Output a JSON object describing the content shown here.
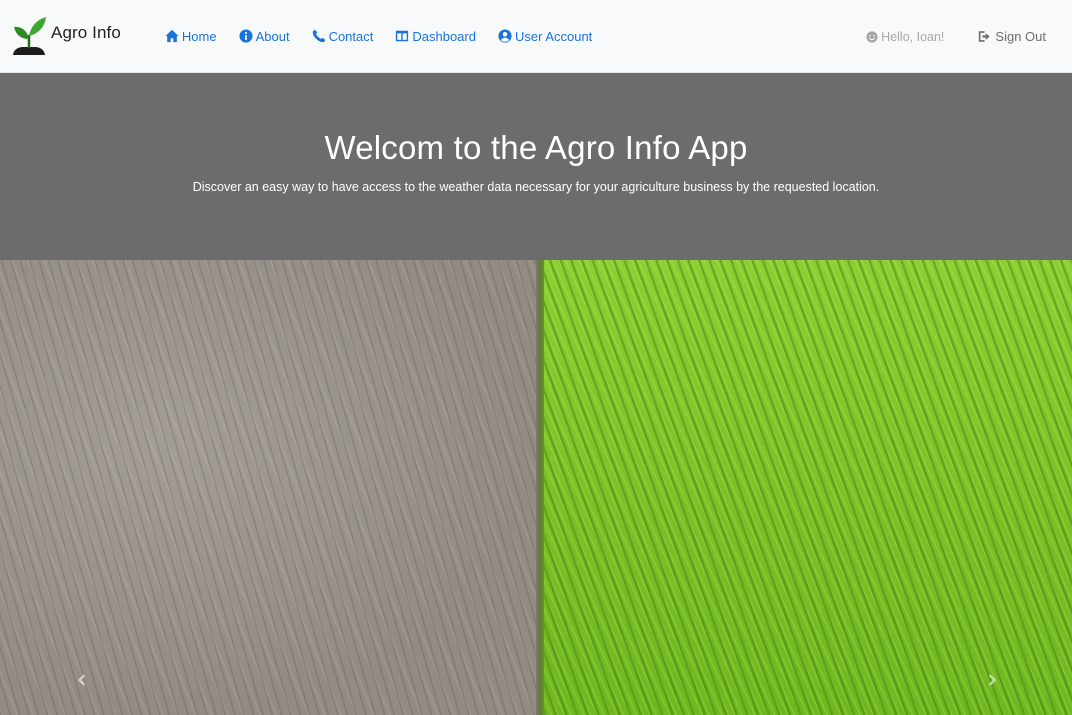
{
  "brand": {
    "name": "Agro Info",
    "icon": "plant-sprout-icon"
  },
  "nav": {
    "items": [
      {
        "label": "Home",
        "icon": "home-icon"
      },
      {
        "label": "About",
        "icon": "info-icon"
      },
      {
        "label": "Contact",
        "icon": "phone-icon"
      },
      {
        "label": "Dashboard",
        "icon": "dashboard-icon"
      },
      {
        "label": "User Account",
        "icon": "user-circle-icon"
      }
    ],
    "greeting": "Hello, Ioan!",
    "greeting_icon": "smile-icon",
    "signout_label": "Sign Out",
    "signout_icon": "sign-out-icon"
  },
  "hero": {
    "title": "Welcom to the Agro Info App",
    "subtitle": "Discover an easy way to have access to the weather data necessary for your agriculture business by the requested location."
  },
  "carousel": {
    "prev_icon": "chevron-left-icon",
    "next_icon": "chevron-right-icon"
  },
  "colors": {
    "nav_link": "#1a73d9",
    "navbar_bg": "#f8f9fa",
    "hero_bg": "#6c6c6c",
    "hero_text": "#ffffff",
    "greeting_text": "#a8a8a8"
  }
}
